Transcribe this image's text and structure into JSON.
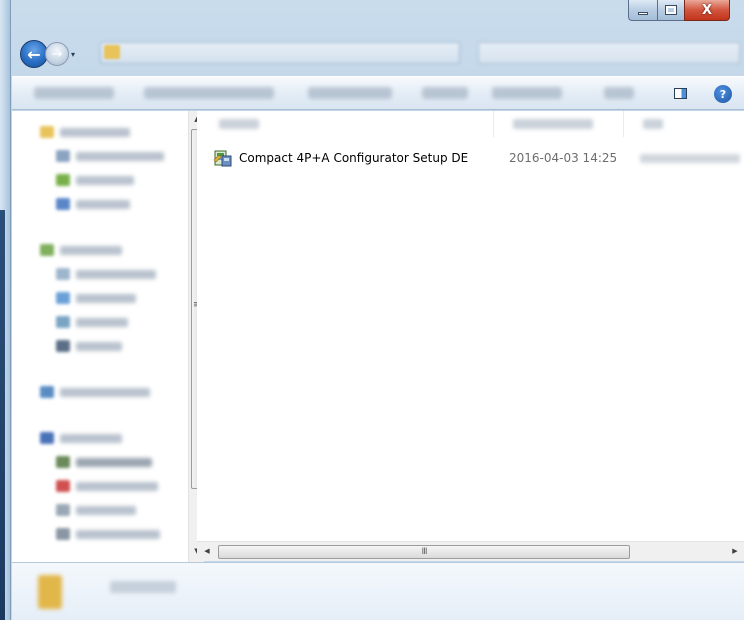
{
  "window": {
    "caption_buttons": {
      "minimize_icon": "minimize-icon",
      "maximize_icon": "maximize-icon",
      "close_label": "X"
    }
  },
  "navigation": {
    "back_icon": "back-arrow-icon",
    "back_glyph": "←",
    "forward_glyph": "→",
    "history_glyph": "▾"
  },
  "toolbar": {
    "help_label": "?"
  },
  "files": [
    {
      "name": "Compact 4P+A Configurator Setup DE",
      "date_modified": "2016-04-03 14:25",
      "icon": "installer-icon"
    }
  ],
  "scrollbars": {
    "vertical_grip": "≡",
    "horizontal_grip": "III"
  },
  "colors": {
    "accent_blue": "#2a6fc4",
    "close_red": "#c2331b",
    "frame": "#b8d0e6"
  }
}
